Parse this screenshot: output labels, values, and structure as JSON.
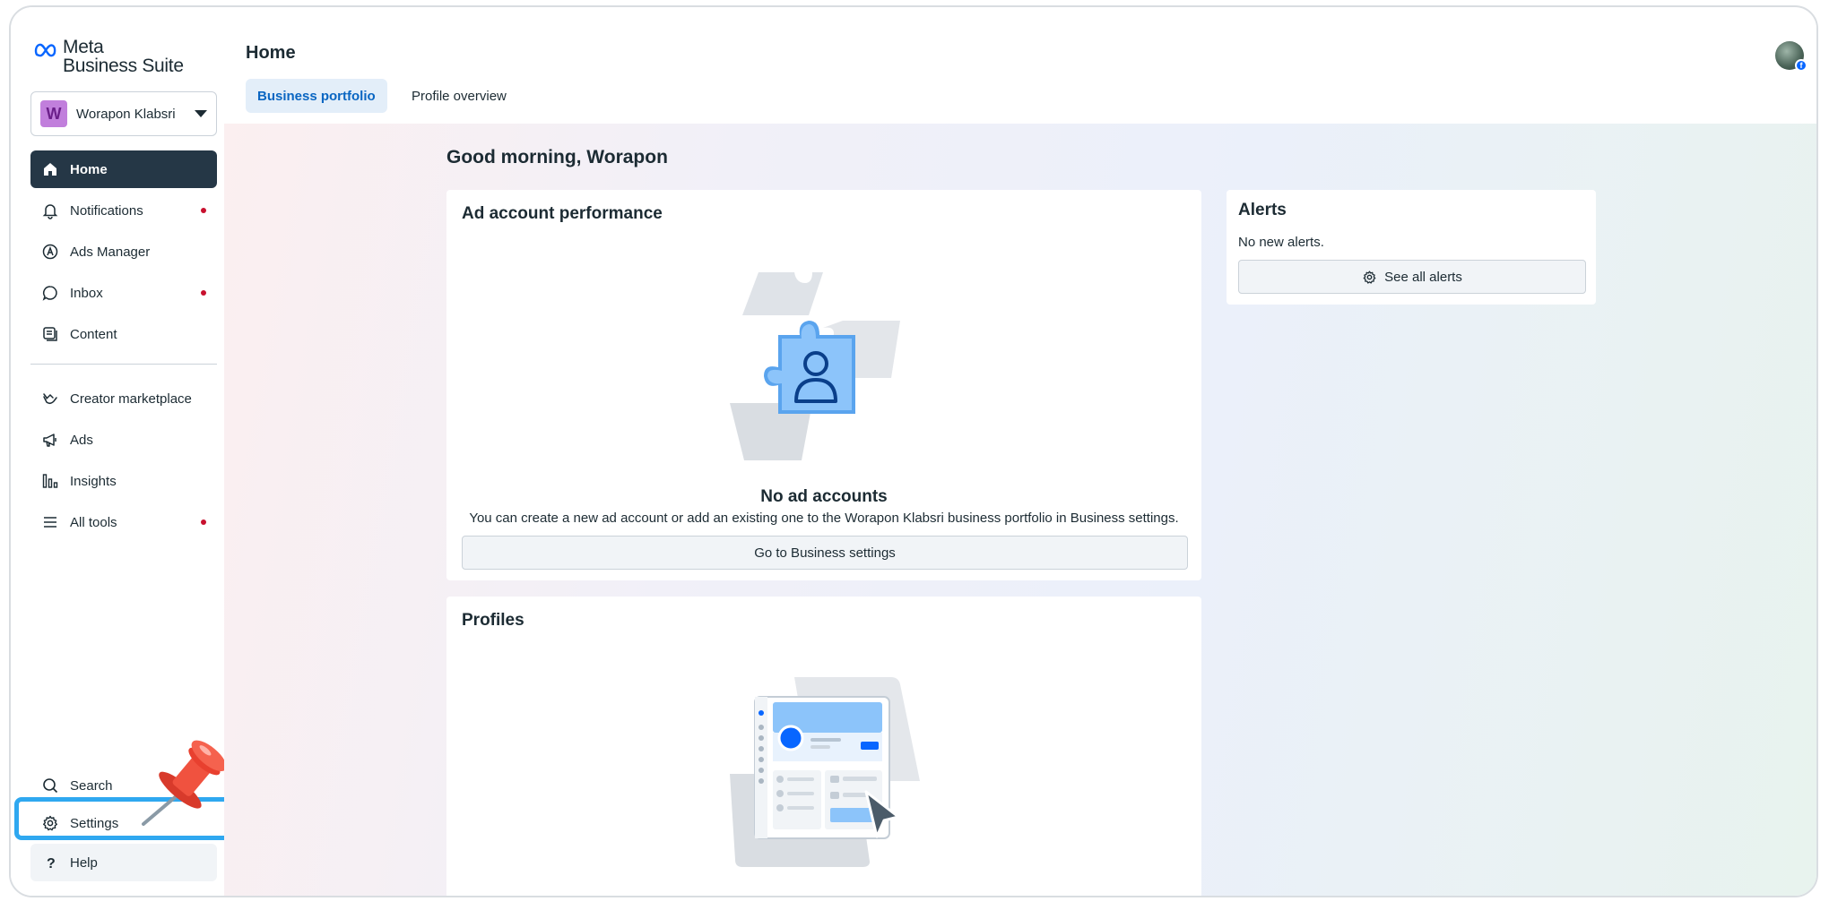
{
  "brand": {
    "line1": "Meta",
    "line2": "Business Suite",
    "accent": "#0866ff"
  },
  "account": {
    "initial": "W",
    "name": "Worapon Klabsri",
    "badge_color": "#c17fdc"
  },
  "sidebar": {
    "items": [
      {
        "label": "Home",
        "icon": "home-icon",
        "active": true,
        "dot": false
      },
      {
        "label": "Notifications",
        "icon": "bell-icon",
        "dot": true
      },
      {
        "label": "Ads Manager",
        "icon": "ads-manager-icon",
        "dot": false
      },
      {
        "label": "Inbox",
        "icon": "chat-bubble-icon",
        "dot": true
      },
      {
        "label": "Content",
        "icon": "content-icon",
        "dot": false
      },
      {
        "label": "Creator marketplace",
        "icon": "handshake-icon",
        "dot": false
      },
      {
        "label": "Ads",
        "icon": "megaphone-icon",
        "dot": false
      },
      {
        "label": "Insights",
        "icon": "bar-chart-icon",
        "dot": false
      },
      {
        "label": "All tools",
        "icon": "menu-icon",
        "dot": true
      }
    ],
    "bottom": [
      {
        "label": "Search",
        "icon": "search-icon"
      },
      {
        "label": "Settings",
        "icon": "gear-icon",
        "highlighted": true
      },
      {
        "label": "Help",
        "icon": "question-icon"
      }
    ],
    "highlight_color": "#2fa8f0"
  },
  "header": {
    "title": "Home",
    "tabs": [
      {
        "label": "Business portfolio",
        "active": true
      },
      {
        "label": "Profile overview",
        "active": false
      }
    ]
  },
  "main": {
    "greeting": "Good morning, Worapon",
    "ad_performance": {
      "title": "Ad account performance",
      "empty_title": "No ad accounts",
      "empty_text": "You can create a new ad account or add an existing one to the Worapon Klabsri business portfolio in Business settings.",
      "button": "Go to Business settings"
    },
    "profiles": {
      "title": "Profiles"
    },
    "alerts": {
      "title": "Alerts",
      "text": "No new alerts.",
      "button": "See all alerts"
    }
  }
}
